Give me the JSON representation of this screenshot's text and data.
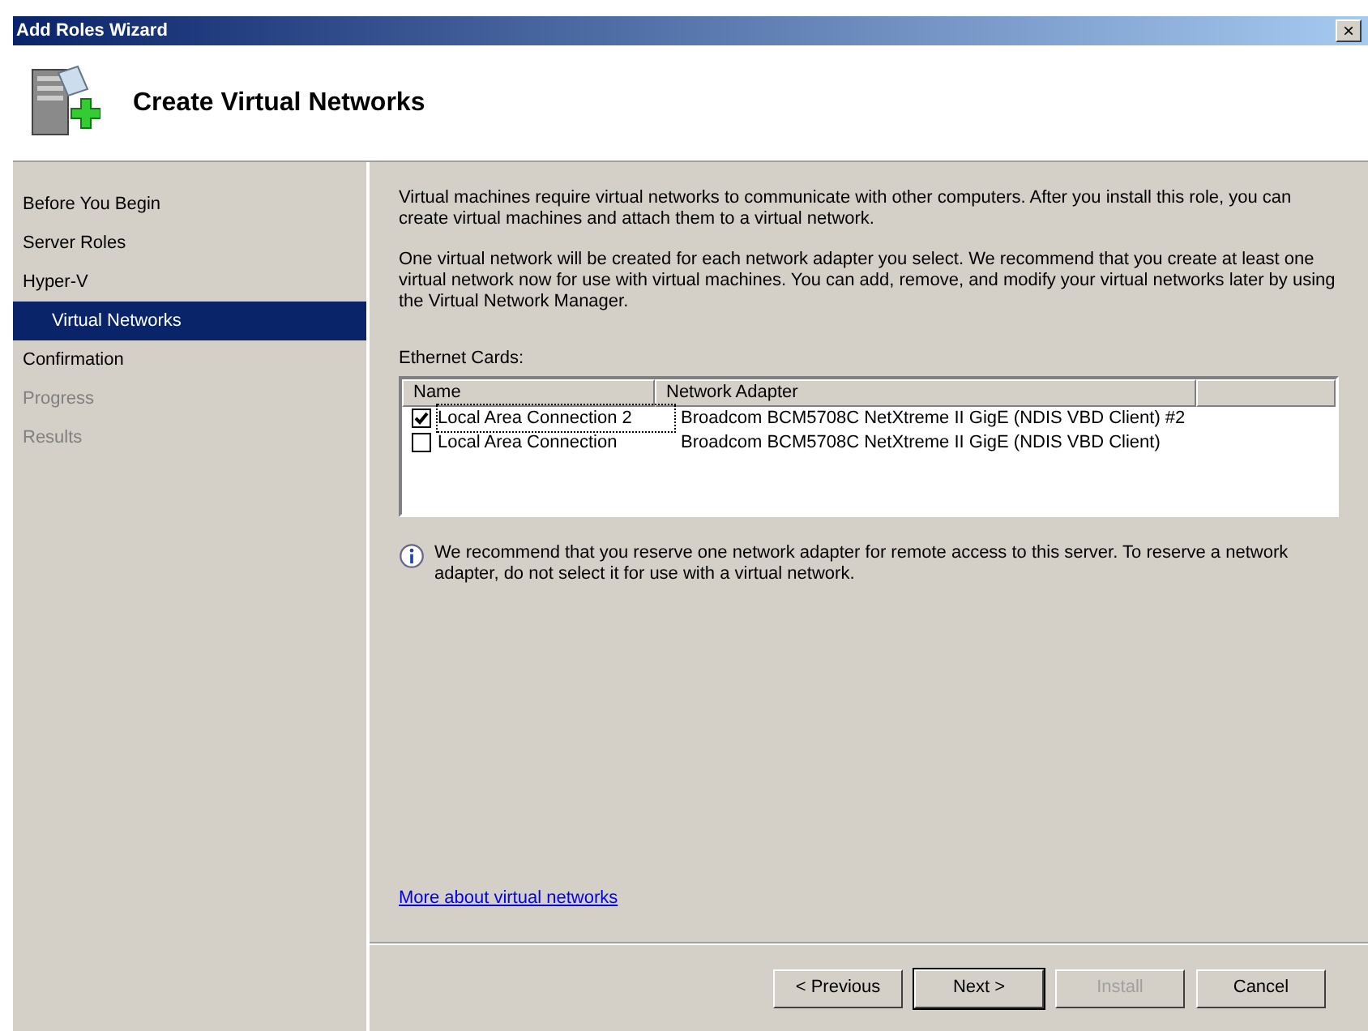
{
  "window": {
    "title": "Add Roles Wizard",
    "close": "×"
  },
  "header": {
    "title": "Create Virtual Networks"
  },
  "sidebar": {
    "items": [
      {
        "label": "Before You Begin",
        "selected": false,
        "disabled": false
      },
      {
        "label": "Server Roles",
        "selected": false,
        "disabled": false
      },
      {
        "label": "Hyper-V",
        "selected": false,
        "disabled": false,
        "children": [
          {
            "label": "Virtual Networks",
            "selected": true,
            "disabled": false
          }
        ]
      },
      {
        "label": "Confirmation",
        "selected": false,
        "disabled": false
      },
      {
        "label": "Progress",
        "selected": false,
        "disabled": true
      },
      {
        "label": "Results",
        "selected": false,
        "disabled": true
      }
    ]
  },
  "content": {
    "paragraphs": [
      "Virtual machines require virtual networks to communicate with other computers. After you install this role, you can create virtual machines and attach them to a virtual network.",
      "One virtual network will be created for each network adapter you select. We recommend that you create at least one virtual network now for use with virtual machines. You can add, remove, and modify your virtual networks later by using the Virtual Network Manager."
    ],
    "list_label": "Ethernet Cards:",
    "table": {
      "columns": [
        "Name",
        "Network Adapter"
      ],
      "rows": [
        {
          "name": "Local Area Connection 2",
          "adapter": "Broadcom BCM5708C NetXtreme II GigE (NDIS VBD Client) #2",
          "checked": true,
          "focused": true
        },
        {
          "name": "Local Area Connection",
          "adapter": "Broadcom BCM5708C NetXtreme II GigE (NDIS VBD Client)",
          "checked": false,
          "focused": false
        }
      ]
    },
    "info": "We recommend that you reserve one network adapter for remote access to this server. To reserve a network adapter, do not select it for use with a virtual network.",
    "link": "More about virtual networks"
  },
  "buttons": [
    {
      "label": "< Previous",
      "disabled": false,
      "default": false
    },
    {
      "label": "Next >",
      "disabled": false,
      "default": true
    },
    {
      "label": "Install",
      "disabled": true,
      "default": false
    },
    {
      "label": "Cancel",
      "disabled": false,
      "default": false
    }
  ]
}
